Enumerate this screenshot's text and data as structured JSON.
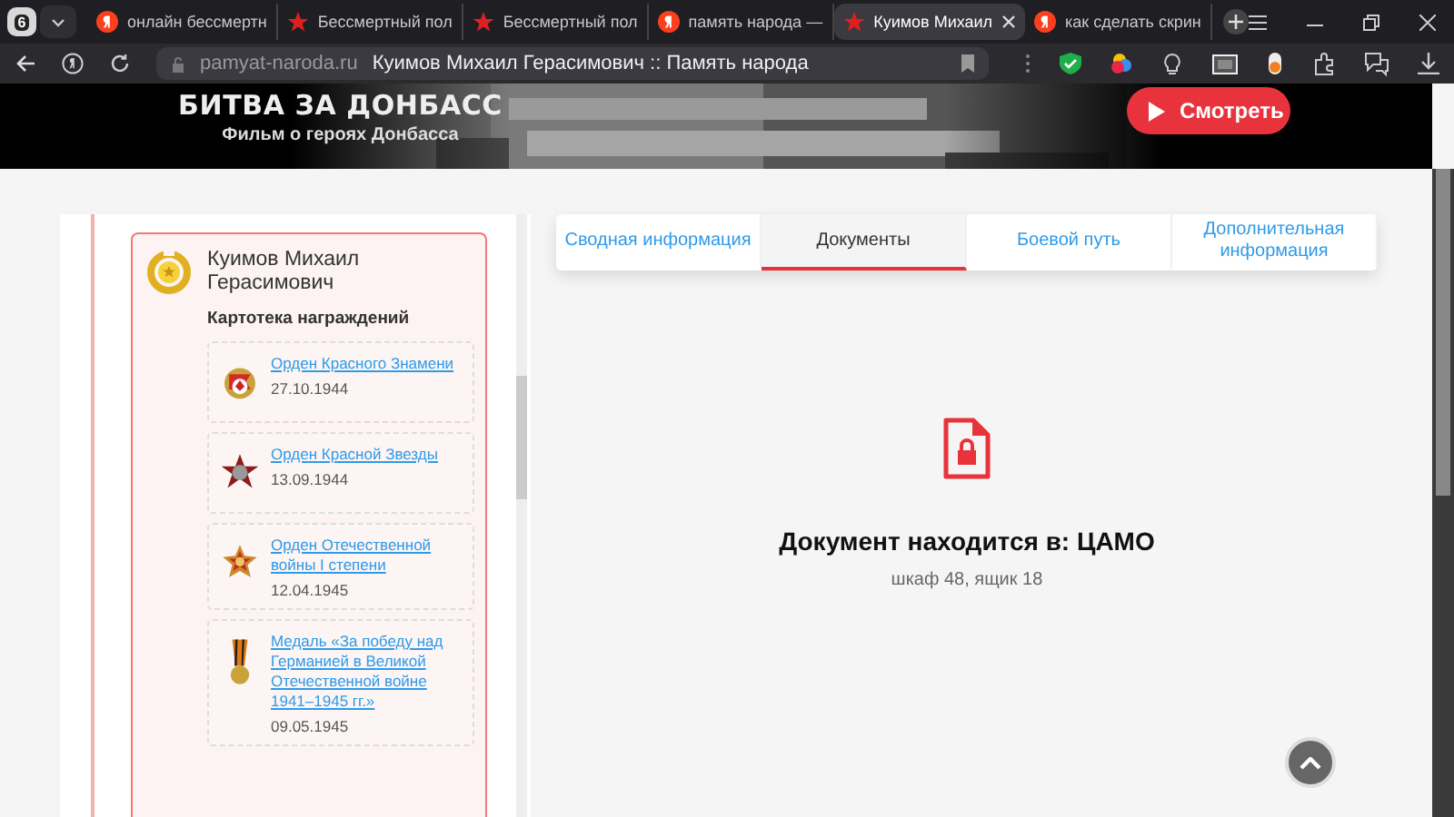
{
  "browser": {
    "tab_count": "6",
    "tabs": [
      {
        "title": "онлайн бессмертн",
        "kind": "yandex",
        "selected": false
      },
      {
        "title": "Бессмертный пол",
        "kind": "star",
        "selected": false
      },
      {
        "title": "Бессмертный пол",
        "kind": "star",
        "selected": false
      },
      {
        "title": "память народа —",
        "kind": "yandex",
        "selected": false
      },
      {
        "title": "Куимов Михаил",
        "kind": "star",
        "selected": true
      },
      {
        "title": "как сделать скрин",
        "kind": "yandex",
        "selected": false
      }
    ],
    "address": {
      "domain": "pamyat-naroda.ru",
      "page_title": "Куимов Михаил Герасимович :: Память народа"
    }
  },
  "banner": {
    "title": "БИТВА ЗА ДОНБАСС",
    "subtitle": "Фильм о героях Донбасса",
    "button": "Смотреть"
  },
  "person": {
    "name": "Куимов Михаил Герасимович",
    "section": "Картотека награждений",
    "awards": [
      {
        "name": "Орден Красного Знамени",
        "date": "27.10.1944",
        "kind": "banner"
      },
      {
        "name": "Орден Красной Звезды",
        "date": "13.09.1944",
        "kind": "star"
      },
      {
        "name": "Орден Отечественной войны I степени",
        "date": "12.04.1945",
        "kind": "order"
      },
      {
        "name": "Медаль «За победу над Германией в Великой Отечественной войне 1941–1945 гг.»",
        "date": "09.05.1945",
        "kind": "medal"
      }
    ]
  },
  "doc_tabs": [
    {
      "label": "Сводная информация",
      "selected": false
    },
    {
      "label": "Документы",
      "selected": true
    },
    {
      "label": "Боевой путь",
      "selected": false
    },
    {
      "label": "Дополнительная информация",
      "selected": false
    }
  ],
  "document": {
    "location": "Документ находится в: ЦАМО",
    "detail": "шкаф 48, ящик 18"
  }
}
